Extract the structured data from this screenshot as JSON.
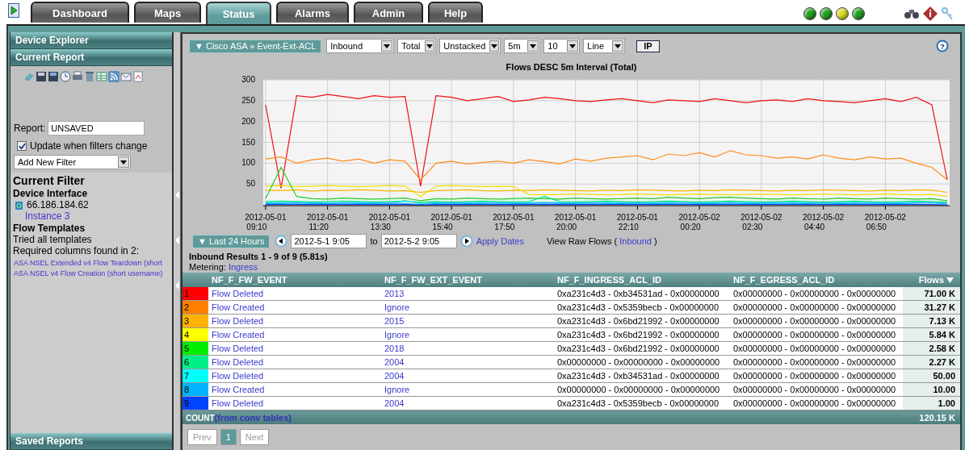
{
  "tabs": [
    {
      "label": "Dashboard",
      "selected": false
    },
    {
      "label": "Maps",
      "selected": false
    },
    {
      "label": "Status",
      "selected": true
    },
    {
      "label": "Alarms",
      "selected": false
    },
    {
      "label": "Admin",
      "selected": false
    },
    {
      "label": "Help",
      "selected": false
    }
  ],
  "status_lights": [
    {
      "color": "#1f9f1f"
    },
    {
      "color": "#1f9f1f"
    },
    {
      "color": "#d8d820"
    },
    {
      "color": "#1f9f1f"
    }
  ],
  "sidebar": {
    "headers": [
      "Device Explorer",
      "Current Report"
    ],
    "report": {
      "label": "Report:",
      "value": "UNSAVED"
    },
    "update_checkbox": {
      "label": "Update when filters change",
      "checked": true
    },
    "filter_select": {
      "value": "Add New Filter"
    },
    "current_filter": {
      "title": "Current Filter",
      "device_heading": "Device Interface",
      "device": "66.186.184.62",
      "instance": "Instance 3",
      "templates_heading": "Flow Templates",
      "templates_lines": [
        "Tried all templates",
        "Required columns found in 2:"
      ],
      "template_links": [
        "ASA NSEL Extended v4 Flow Teardown (short",
        "ASA NSEL v4 Flow Creation (short username)"
      ]
    },
    "footer_header": "Saved Reports"
  },
  "toolbar": {
    "breadcrumb": "▼ Cisco ASA » Event-Ext-ACL",
    "selects": [
      {
        "value": "Inbound"
      },
      {
        "value": "Total"
      },
      {
        "value": "Unstacked"
      },
      {
        "value": "5m"
      },
      {
        "value": "10"
      },
      {
        "value": "Line"
      }
    ],
    "ip_button": "IP",
    "help_icon": "?"
  },
  "chart": {
    "chart_data": {
      "type": "line",
      "title": "Flows DESC 5m Interval (Total)",
      "categories": [
        "2012-05-01 09:10",
        null,
        null,
        null,
        "2012-05-01 11:20",
        null,
        null,
        null,
        "2012-05-01 13:30",
        null,
        null,
        null,
        "2012-05-01 15:40",
        null,
        null,
        null,
        "2012-05-01 17:50",
        null,
        null,
        null,
        "2012-05-01 20:00",
        null,
        null,
        null,
        "2012-05-01 22:10",
        null,
        null,
        null,
        "2012-05-02 00:20",
        null,
        null,
        null,
        "2012-05-02 02:30",
        null,
        null,
        null,
        "2012-05-02 04:40",
        null,
        null,
        null,
        "2012-05-02 06:50",
        null,
        null,
        null,
        null
      ],
      "ylim": [
        0,
        300
      ],
      "grid": true,
      "yticks": [
        50,
        100,
        150,
        200,
        250,
        300
      ],
      "series": [
        {
          "color": "#ee1111",
          "values": [
            240,
            40,
            262,
            258,
            265,
            260,
            255,
            262,
            258,
            260,
            45,
            262,
            258,
            250,
            255,
            260,
            248,
            252,
            258,
            255,
            250,
            248,
            252,
            255,
            250,
            245,
            252,
            250,
            248,
            255,
            250,
            245,
            250,
            252,
            248,
            255,
            250,
            248,
            245,
            250,
            255,
            248,
            258,
            240,
            60
          ]
        },
        {
          "color": "#ff8c1a",
          "values": [
            110,
            115,
            100,
            108,
            112,
            105,
            110,
            100,
            108,
            105,
            60,
            100,
            105,
            98,
            102,
            105,
            100,
            108,
            104,
            98,
            110,
            105,
            112,
            115,
            118,
            108,
            122,
            118,
            125,
            115,
            130,
            120,
            118,
            112,
            115,
            110,
            120,
            112,
            108,
            115,
            110,
            112,
            100,
            90,
            60
          ]
        },
        {
          "color": "#ffb000",
          "values": [
            35,
            34,
            36,
            33,
            35,
            34,
            36,
            35,
            33,
            34,
            30,
            34,
            35,
            36,
            34,
            33,
            35,
            34,
            36,
            35,
            34,
            33,
            35,
            34,
            36,
            35,
            34,
            33,
            35,
            34,
            36,
            35,
            34,
            33,
            35,
            34,
            36,
            35,
            34,
            33,
            35,
            34,
            36,
            35,
            30
          ]
        },
        {
          "color": "#f0e000",
          "values": [
            45,
            46,
            44,
            45,
            46,
            45,
            44,
            45,
            46,
            45,
            20,
            45,
            46,
            45,
            44,
            45,
            44,
            25,
            24,
            25,
            26,
            25,
            24,
            25,
            26,
            25,
            24,
            25,
            26,
            25,
            24,
            25,
            26,
            25,
            24,
            25,
            26,
            25,
            24,
            25,
            26,
            25,
            24,
            25,
            20
          ]
        },
        {
          "color": "#22cc22",
          "values": [
            15,
            90,
            20,
            15,
            14,
            16,
            15,
            14,
            15,
            16,
            10,
            15,
            14,
            16,
            15,
            14,
            15,
            16,
            15,
            14,
            16,
            15,
            14,
            15,
            16,
            15,
            18,
            16,
            15,
            17,
            18,
            16,
            15,
            14,
            16,
            15,
            14,
            16,
            15,
            14,
            16,
            15,
            14,
            15,
            10
          ]
        },
        {
          "color": "#00e88a",
          "values": [
            8,
            9,
            8,
            7,
            8,
            9,
            8,
            7,
            8,
            9,
            6,
            8,
            7,
            8,
            9,
            8,
            7,
            8,
            20,
            8,
            7,
            8,
            9,
            8,
            7,
            8,
            9,
            8,
            7,
            8,
            9,
            8,
            7,
            8,
            9,
            8,
            7,
            8,
            9,
            8,
            7,
            8,
            9,
            8,
            6
          ]
        },
        {
          "color": "#00dddd",
          "values": [
            5,
            5,
            6,
            5,
            4,
            5,
            6,
            5,
            4,
            10,
            3,
            5,
            4,
            5,
            6,
            5,
            4,
            5,
            6,
            5,
            4,
            5,
            6,
            5,
            4,
            5,
            6,
            5,
            4,
            5,
            6,
            5,
            4,
            5,
            6,
            5,
            4,
            5,
            6,
            5,
            4,
            5,
            6,
            5,
            4
          ]
        },
        {
          "color": "#22aaff",
          "values": [
            3,
            3,
            4,
            3,
            3,
            4,
            3,
            3,
            4,
            3,
            1,
            3,
            4,
            3,
            3,
            4,
            3,
            3,
            4,
            3,
            3,
            4,
            3,
            3,
            4,
            3,
            3,
            4,
            3,
            3,
            4,
            3,
            3,
            4,
            3,
            3,
            4,
            3,
            3,
            4,
            3,
            3,
            4,
            5,
            2
          ]
        },
        {
          "color": "#0044ff",
          "values": [
            1,
            1,
            1,
            1,
            1,
            1,
            1,
            1,
            1,
            1,
            0,
            1,
            1,
            1,
            1,
            1,
            1,
            1,
            1,
            1,
            1,
            1,
            1,
            1,
            1,
            1,
            1,
            1,
            1,
            1,
            1,
            1,
            1,
            1,
            1,
            1,
            1,
            1,
            1,
            1,
            1,
            1,
            1,
            1,
            0
          ]
        }
      ]
    }
  },
  "dates": {
    "range_button": "▼ Last 24 Hours",
    "from": "2012-5-1 9:05",
    "to_label": "to",
    "to": "2012-5-2 9:05",
    "apply": "Apply Dates",
    "raw_flows": "View Raw Flows (",
    "raw_link": "Inbound",
    "raw_suffix": ")"
  },
  "results": {
    "title": "Inbound Results 1 - 9 of 9 (5.81s)",
    "metering_label": "Metering:",
    "metering_link": "Ingress"
  },
  "table": {
    "columns": [
      "NF_F_FW_EVENT",
      "NF_F_FW_EXT_EVENT",
      "NF_F_INGRESS_ACL_ID",
      "NF_F_EGRESS_ACL_ID",
      "Flows"
    ],
    "rows": [
      {
        "index": "1",
        "color": "#ff0000",
        "event": "Flow Deleted",
        "ext_event": "2013",
        "ingress": "0xa231c4d3 - 0xb34531ad - 0x00000000",
        "egress": "0x00000000 - 0x00000000 - 0x00000000",
        "flows": "71.00 K"
      },
      {
        "index": "2",
        "color": "#ff7f00",
        "event": "Flow Created",
        "ext_event": "Ignore",
        "ingress": "0xa231c4d3 - 0x5359becb - 0x00000000",
        "egress": "0x00000000 - 0x00000000 - 0x00000000",
        "flows": "31.27 K"
      },
      {
        "index": "3",
        "color": "#ffb300",
        "event": "Flow Deleted",
        "ext_event": "2015",
        "ingress": "0xa231c4d3 - 0x6bd21992 - 0x00000000",
        "egress": "0x00000000 - 0x00000000 - 0x00000000",
        "flows": "7.13 K"
      },
      {
        "index": "4",
        "color": "#ffff00",
        "event": "Flow Created",
        "ext_event": "Ignore",
        "ingress": "0xa231c4d3 - 0x6bd21992 - 0x00000000",
        "egress": "0x00000000 - 0x00000000 - 0x00000000",
        "flows": "5.84 K"
      },
      {
        "index": "5",
        "color": "#00ee00",
        "event": "Flow Deleted",
        "ext_event": "2018",
        "ingress": "0xa231c4d3 - 0x6bd21992 - 0x00000000",
        "egress": "0x00000000 - 0x00000000 - 0x00000000",
        "flows": "2.58 K"
      },
      {
        "index": "6",
        "color": "#00ee88",
        "event": "Flow Deleted",
        "ext_event": "2004",
        "ingress": "0x00000000 - 0x00000000 - 0x00000000",
        "egress": "0x00000000 - 0x00000000 - 0x00000000",
        "flows": "2.27 K"
      },
      {
        "index": "7",
        "color": "#00ffff",
        "event": "Flow Deleted",
        "ext_event": "2004",
        "ingress": "0xa231c4d3 - 0xb34531ad - 0x00000000",
        "egress": "0x00000000 - 0x00000000 - 0x00000000",
        "flows": "50.00"
      },
      {
        "index": "8",
        "color": "#00b4ff",
        "event": "Flow Created",
        "ext_event": "Ignore",
        "ingress": "0x00000000 - 0x00000000 - 0x00000000",
        "egress": "0x00000000 - 0x00000000 - 0x00000000",
        "flows": "10.00"
      },
      {
        "index": "9",
        "color": "#0044ff",
        "event": "Flow Deleted",
        "ext_event": "2004",
        "ingress": "0xa231c4d3 - 0x5359becb - 0x00000000",
        "egress": "0x00000000 - 0x00000000 - 0x00000000",
        "flows": "1.00"
      }
    ],
    "count_label": "COUNT",
    "count_link": "(from conv tables)",
    "count_total": "120.15 K"
  },
  "pager": {
    "prev": {
      "label": "Prev",
      "disabled": true
    },
    "pages": [
      {
        "label": "1",
        "selected": true
      }
    ],
    "next": {
      "label": "Next",
      "disabled": true
    }
  }
}
